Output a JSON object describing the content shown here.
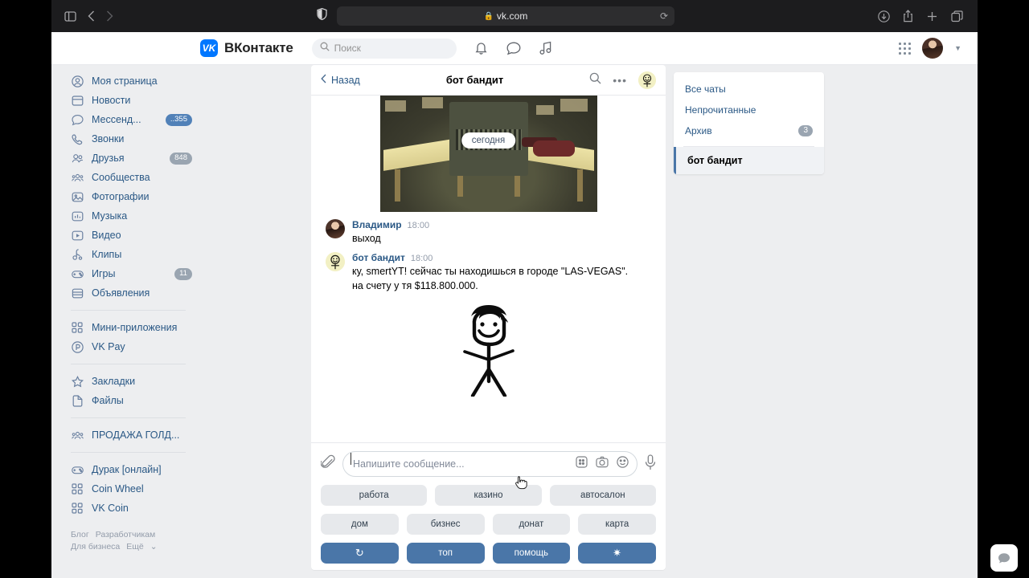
{
  "browser": {
    "url": "vk.com",
    "lock_icon": "lock-icon",
    "sidebar_toggle_icon": "sidebar-toggle-icon",
    "back_icon": "back-arrow-icon",
    "forward_icon": "forward-arrow-icon",
    "shield_icon": "privacy-shield-icon",
    "reload_icon": "reload-icon",
    "downloads_icon": "downloads-icon",
    "share_icon": "share-icon",
    "newtab_icon": "new-tab-icon",
    "tabs_icon": "tab-overview-icon"
  },
  "header": {
    "logo_mark": "VK",
    "logo_text": "ВКонтакте",
    "search_placeholder": "Поиск",
    "search_icon": "search-icon",
    "bell_icon": "bell-icon",
    "messages_icon": "chat-bubble-icon",
    "music_icon": "music-note-icon",
    "apps_icon": "apps-grid-icon",
    "avatar": "user-avatar",
    "caret_icon": "chevron-down-icon"
  },
  "sidebar": {
    "items": [
      {
        "label": "Моя страница",
        "icon": "profile-icon"
      },
      {
        "label": "Новости",
        "icon": "news-icon"
      },
      {
        "label": "Мессенд...",
        "icon": "messenger-icon",
        "badge": "..355",
        "badge_style": "blue"
      },
      {
        "label": "Звонки",
        "icon": "phone-icon"
      },
      {
        "label": "Друзья",
        "icon": "friends-icon",
        "badge": "848",
        "badge_style": "gray"
      },
      {
        "label": "Сообщества",
        "icon": "groups-icon"
      },
      {
        "label": "Фотографии",
        "icon": "photo-icon"
      },
      {
        "label": "Музыка",
        "icon": "music-box-icon"
      },
      {
        "label": "Видео",
        "icon": "video-icon"
      },
      {
        "label": "Клипы",
        "icon": "clips-icon"
      },
      {
        "label": "Игры",
        "icon": "gamepad-icon",
        "badge": "11",
        "badge_style": "gray"
      },
      {
        "label": "Объявления",
        "icon": "ads-icon"
      }
    ],
    "group2": [
      {
        "label": "Мини-приложения",
        "icon": "mini-apps-icon"
      },
      {
        "label": "VK Pay",
        "icon": "vk-pay-icon"
      }
    ],
    "group3": [
      {
        "label": "Закладки",
        "icon": "star-icon"
      },
      {
        "label": "Файлы",
        "icon": "file-icon"
      }
    ],
    "group4": [
      {
        "label": "ПРОДАЖА ГОЛД...",
        "icon": "groups-icon"
      }
    ],
    "group5": [
      {
        "label": "Дурак [онлайн]",
        "icon": "gamepad-icon"
      },
      {
        "label": "Coin Wheel",
        "icon": "mini-apps-icon"
      },
      {
        "label": "VK Coin",
        "icon": "mini-apps-icon"
      }
    ],
    "footer": [
      "Блог",
      "Разработчикам",
      "Для бизнеса",
      "Ещё"
    ]
  },
  "chat": {
    "back_label": "Назад",
    "back_icon": "chevron-left-icon",
    "title": "бот бандит",
    "search_icon": "search-icon",
    "more_icon": "more-dots-icon",
    "avatar_icon": "bot-avatar",
    "date_divider": "сегодня",
    "photo_alt": "game-screenshot",
    "messages": [
      {
        "author": "Владимир",
        "time": "18:00",
        "text": "выход",
        "avatar": "user-avatar"
      },
      {
        "author": "бот бандит",
        "time": "18:00",
        "text": "ку, smertYT! сейчас ты находишься в городе \"LAS-VEGAS\".",
        "text2": "на счету у тя $118.800.000.",
        "avatar": "bot-avatar"
      }
    ],
    "sticker": "stick-figure-sticker"
  },
  "composer": {
    "attach_icon": "paperclip-icon",
    "placeholder": "Напишите сообщение...",
    "keyboard_icon": "bot-keyboard-icon",
    "camera_icon": "camera-icon",
    "emoji_icon": "smiley-icon",
    "mic_icon": "microphone-icon",
    "keyboard_rows": [
      [
        {
          "label": "работа",
          "style": "light"
        },
        {
          "label": "казино",
          "style": "light"
        },
        {
          "label": "автосалон",
          "style": "light"
        }
      ],
      [
        {
          "label": "дом",
          "style": "light"
        },
        {
          "label": "бизнес",
          "style": "light"
        },
        {
          "label": "донат",
          "style": "light"
        },
        {
          "label": "карта",
          "style": "light"
        }
      ],
      [
        {
          "label": "↻",
          "style": "primary",
          "icon": "refresh-icon"
        },
        {
          "label": "топ",
          "style": "primary"
        },
        {
          "label": "помощь",
          "style": "primary"
        },
        {
          "label": "✷",
          "style": "primary",
          "icon": "settings-icon"
        }
      ]
    ]
  },
  "right_panel": {
    "items": [
      {
        "label": "Все чаты"
      },
      {
        "label": "Непрочитанные"
      },
      {
        "label": "Архив",
        "count": "3"
      }
    ],
    "active_chat": "бот бандит"
  },
  "fab": {
    "icon": "chat-bubble-icon"
  },
  "colors": {
    "vk_blue": "#0077ff",
    "link_blue": "#2a5885",
    "button_blue": "#4a76a8",
    "page_bg": "#edeef0",
    "badge_blue": "#5181b8",
    "badge_gray": "#9aa5b1"
  }
}
